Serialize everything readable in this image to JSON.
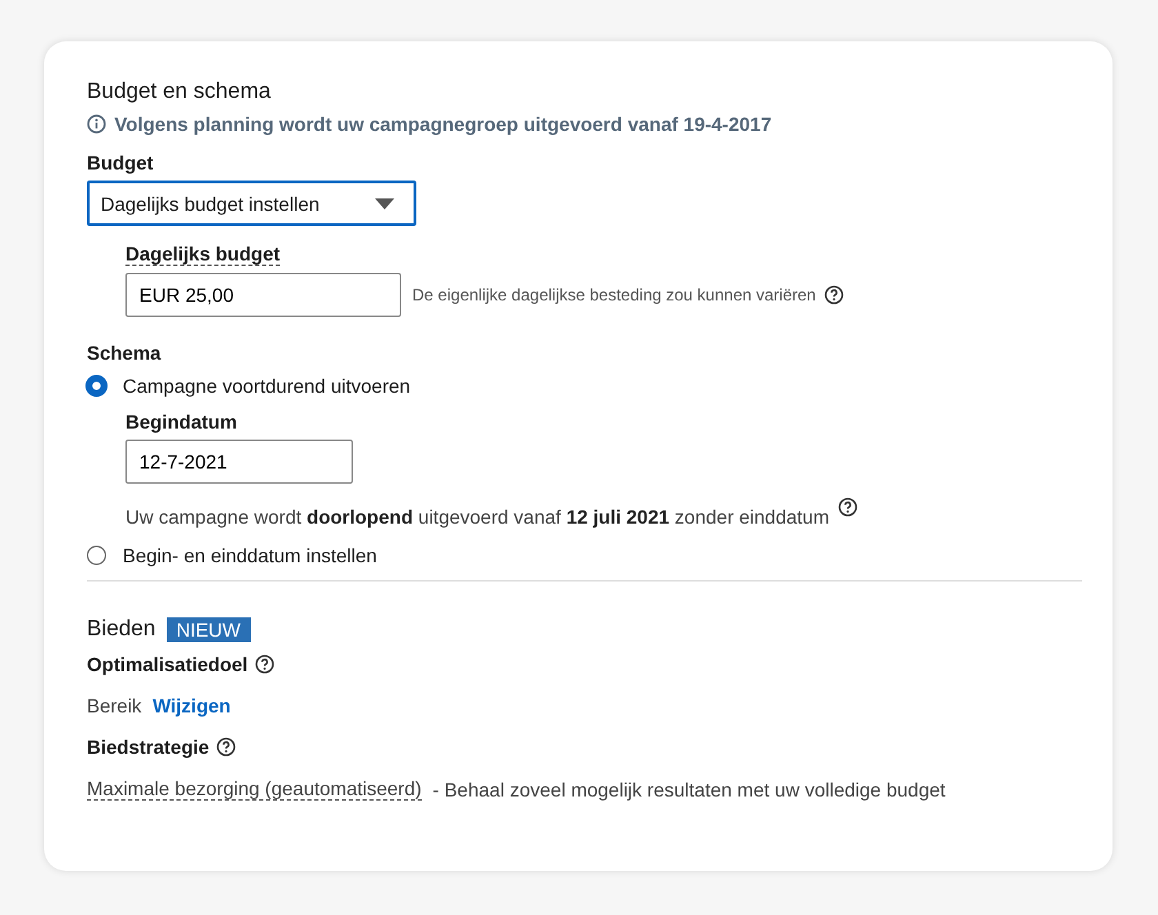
{
  "section_title": "Budget en schema",
  "info_notice": "Volgens planning wordt uw campagnegroep uitgevoerd vanaf 19-4-2017",
  "budget": {
    "label": "Budget",
    "dropdown_value": "Dagelijks budget instellen",
    "amount_label": "Dagelijks budget",
    "amount_value": "EUR 25,00",
    "amount_hint": "De eigenlijke dagelijkse besteding zou kunnen variëren"
  },
  "schedule": {
    "label": "Schema",
    "options": [
      {
        "label": "Campagne voortdurend uitvoeren",
        "selected": true,
        "start_label": "Begindatum",
        "start_value": "12-7-2021",
        "note": "Uw campagne wordt **doorlopend** uitgevoerd vanaf **12 juli 2021** zonder einddatum"
      },
      {
        "label": "Begin- en einddatum instellen",
        "selected": false
      }
    ]
  },
  "bidding": {
    "title": "Bieden",
    "badge": "NIEUW",
    "goal_label": "Optimalisatiedoel",
    "goal_value": "Bereik",
    "goal_link": "Wijzigen",
    "strategy_label": "Biedstrategie",
    "strategy_term": "Maximale bezorging (geautomatiseerd)",
    "strategy_description": "- Behaal zoveel mogelijk resultaten met uw volledige budget"
  }
}
